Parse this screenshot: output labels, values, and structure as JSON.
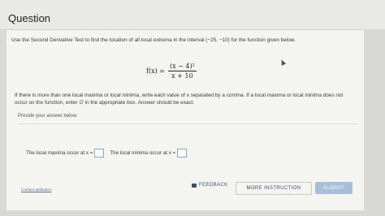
{
  "header": {
    "title": "Question"
  },
  "question": {
    "prompt": "Use the Second Derivative Test to find the location of all local extrema in the interval (−25, −10) for the function given below.",
    "function_lhs": "f(x) =",
    "numerator": "(x − 4)²",
    "denominator": "x + 10",
    "instructions": "If there is more than one local maxima or local minima, write each value of x separated by a comma. If a local maxima or local minima does not occur on the function, enter ∅ in the appropriate box. Answer should be exact."
  },
  "answer": {
    "section_label": "Provide your answer below:",
    "maxima_label": "The local maxima occur at x =",
    "minima_label": "The local minima occur at x ="
  },
  "footer": {
    "attribution": "Content attribution",
    "feedback_label": "FEEDBACK",
    "more_instruction_label": "MORE INSTRUCTION",
    "submit_label": "SUBMIT"
  }
}
